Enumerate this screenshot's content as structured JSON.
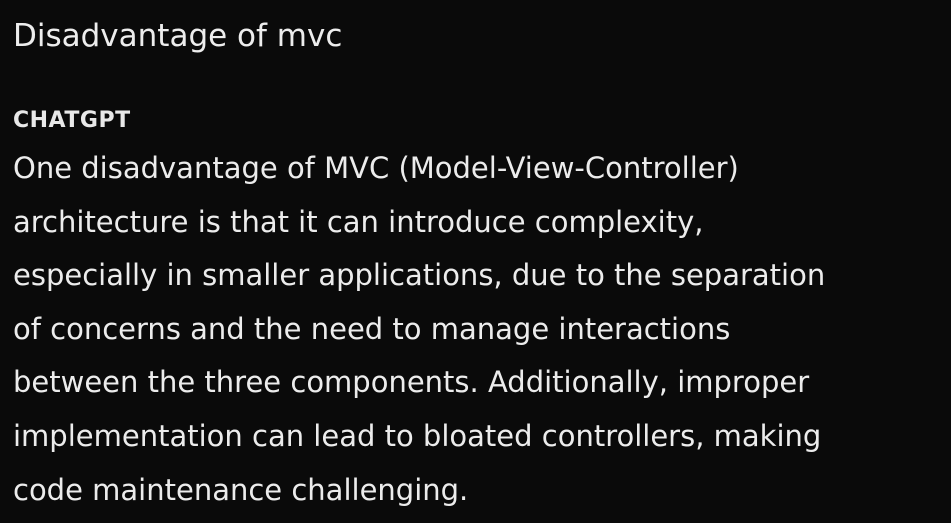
{
  "user_message": "Disadvantage of mvc",
  "sender_label": "CHATGPT",
  "response_lines": [
    "One disadvantage of MVC (Model-View-Controller)",
    "architecture is that it can introduce complexity,",
    "especially in smaller applications, due to the separation",
    "of concerns and the need to manage interactions",
    "between the three components. Additionally, improper",
    "implementation can lead to bloated controllers, making",
    "code maintenance challenging."
  ],
  "colors": {
    "background": "#0a0a0a",
    "text": "#ececec"
  }
}
